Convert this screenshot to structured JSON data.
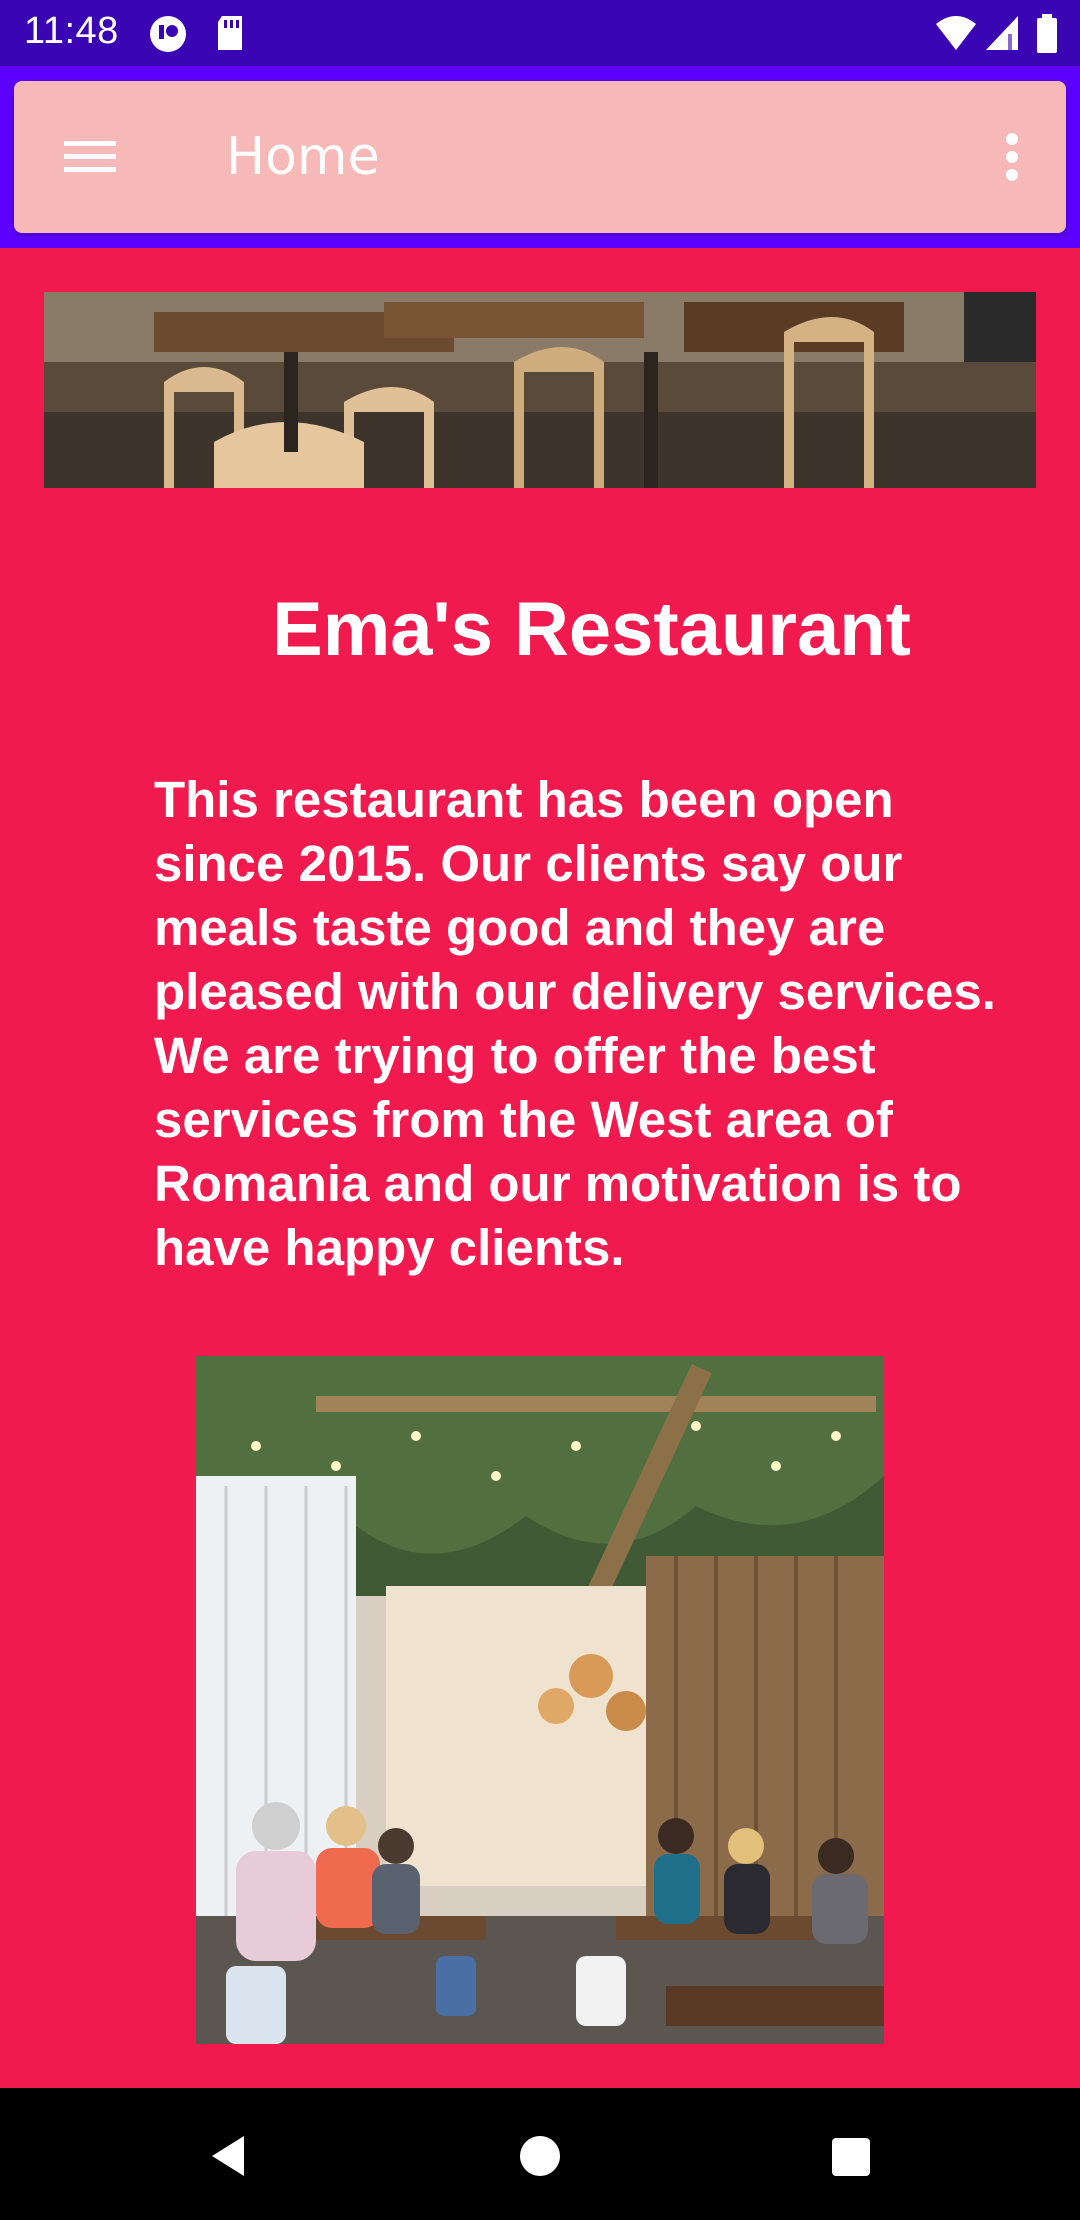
{
  "status_bar": {
    "time": "11:48",
    "icons": [
      "notification-app-icon",
      "sd-card-icon",
      "wifi-icon",
      "signal-icon",
      "battery-icon"
    ]
  },
  "app_bar": {
    "title": "Home",
    "menu_icon": "hamburger-menu-icon",
    "overflow_icon": "more-vert-icon"
  },
  "main": {
    "restaurant_name": "Ema's Restaurant",
    "description": "This restaurant has been open since 2015. Our clients say our meals taste good and they are pleased with our delivery services. We are trying to offer the best services from the West area of Romania and our motivation is to have happy clients."
  },
  "fab": {
    "icon": "mail-icon"
  },
  "nav_bar": {
    "icons": [
      "back-icon",
      "home-icon",
      "recents-icon"
    ]
  },
  "colors": {
    "status_bar": "#3a06b3",
    "app_bar_frame": "#5c00ff",
    "app_bar": "#f7b8b8",
    "content_background": "#f01a4f",
    "fab": "#11e0c9"
  }
}
